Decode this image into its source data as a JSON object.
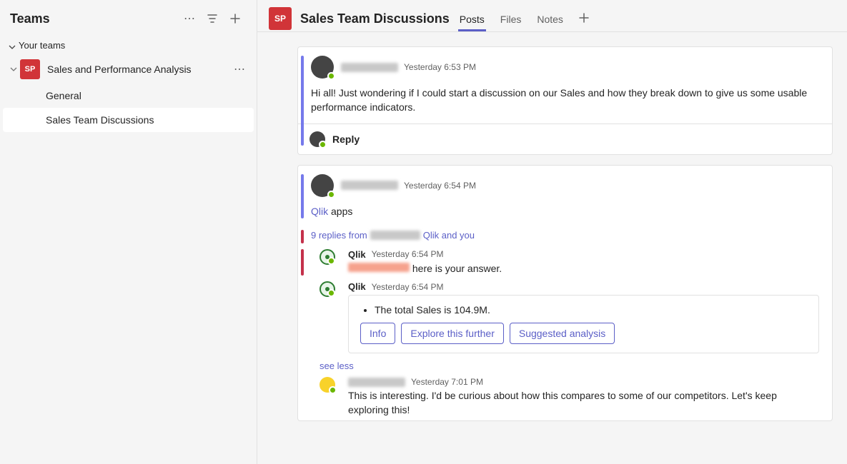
{
  "sidebar": {
    "title": "Teams",
    "section_label": "Your teams",
    "team": {
      "badge": "SP",
      "name": "Sales and Performance Analysis",
      "channels": [
        "General",
        "Sales Team Discussions"
      ],
      "selected_index": 1
    }
  },
  "header": {
    "badge": "SP",
    "title": "Sales Team Discussions",
    "tabs": [
      "Posts",
      "Files",
      "Notes"
    ],
    "active_tab_index": 0
  },
  "posts": [
    {
      "timestamp": "Yesterday 6:53 PM",
      "text": "Hi all! Just wondering if I could start a discussion on our Sales and how they break down to give us some usable performance indicators.",
      "reply_label": "Reply"
    },
    {
      "timestamp": "Yesterday 6:54 PM",
      "link_text": "Qlik",
      "text_after_link": " apps",
      "replies_summary_prefix": "9 replies from ",
      "replies_summary_suffix": " Qlik and you",
      "replies": [
        {
          "author": "Qlik",
          "timestamp": "Yesterday 6:54 PM",
          "text_after_name": " here is your answer.",
          "accent": "red"
        },
        {
          "author": "Qlik",
          "timestamp": "Yesterday 6:54 PM",
          "card": {
            "bullet": "The total Sales is 104.9M.",
            "buttons": [
              "Info",
              "Explore this further",
              "Suggested analysis"
            ]
          }
        },
        {
          "avatar": "yellow",
          "timestamp": "Yesterday 7:01 PM",
          "text": "This is interesting. I'd be curious about how this compares to some of our competitors. Let's keep exploring this!"
        }
      ],
      "see_less": "see less"
    }
  ]
}
